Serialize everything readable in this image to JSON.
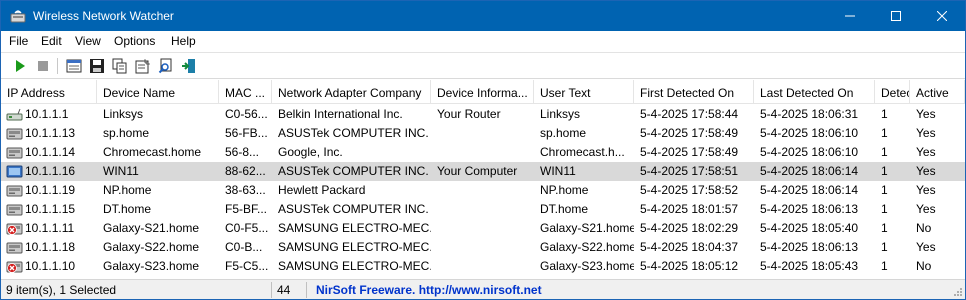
{
  "window": {
    "title": "Wireless Network Watcher"
  },
  "colors": {
    "titlebar": "#0063b1",
    "selected_row": "#d9d9d9",
    "link": "#0033cc",
    "error_red": "#d42020"
  },
  "menu": [
    "File",
    "Edit",
    "View",
    "Options",
    "Help"
  ],
  "toolbar_icons": [
    "play-icon",
    "stop-icon",
    "html-report-icon",
    "save-icon",
    "copy-icon",
    "properties-icon",
    "find-icon",
    "exit-icon"
  ],
  "columns": [
    "IP Address",
    "Device Name",
    "MAC ...",
    "Network Adapter Company",
    "Device Informa...",
    "User Text",
    "First Detected On",
    "Last Detected On",
    "Detec",
    "Active"
  ],
  "rows": [
    {
      "icon": "router-icon",
      "ip": "10.1.1.1",
      "name": "Linksys",
      "mac": "C0-56...",
      "company": "Belkin International Inc.",
      "info": "Your Router",
      "user_text": "Linksys",
      "first": "5-4-2025  17:58:44",
      "last": "5-4-2025  18:06:31",
      "count": "1",
      "active": "Yes",
      "selected": false
    },
    {
      "icon": "device-icon",
      "ip": "10.1.1.13",
      "name": "sp.home",
      "mac": "56-FB...",
      "company": "ASUSTek COMPUTER INC.",
      "info": "",
      "user_text": "sp.home",
      "first": "5-4-2025  17:58:49",
      "last": "5-4-2025  18:06:10",
      "count": "1",
      "active": "Yes",
      "selected": false
    },
    {
      "icon": "device-icon",
      "ip": "10.1.1.14",
      "name": "Chromecast.home",
      "mac": "56-8...",
      "company": "Google, Inc.",
      "info": "",
      "user_text": "Chromecast.h...",
      "first": "5-4-2025  17:58:49",
      "last": "5-4-2025  18:06:10",
      "count": "1",
      "active": "Yes",
      "selected": false
    },
    {
      "icon": "computer-icon",
      "ip": "10.1.1.16",
      "name": "WIN11",
      "mac": "88-62...",
      "company": "ASUSTek COMPUTER INC.",
      "info": "Your Computer",
      "user_text": "WIN11",
      "first": "5-4-2025  17:58:51",
      "last": "5-4-2025  18:06:14",
      "count": "1",
      "active": "Yes",
      "selected": true
    },
    {
      "icon": "device-icon",
      "ip": "10.1.1.19",
      "name": "NP.home",
      "mac": "38-63...",
      "company": "Hewlett Packard",
      "info": "",
      "user_text": "NP.home",
      "first": "5-4-2025  17:58:52",
      "last": "5-4-2025  18:06:14",
      "count": "1",
      "active": "Yes",
      "selected": false
    },
    {
      "icon": "device-icon",
      "ip": "10.1.1.15",
      "name": "DT.home",
      "mac": "F5-BF...",
      "company": "ASUSTek COMPUTER INC.",
      "info": "",
      "user_text": "DT.home",
      "first": "5-4-2025  18:01:57",
      "last": "5-4-2025  18:06:13",
      "count": "1",
      "active": "Yes",
      "selected": false
    },
    {
      "icon": "device-inactive-icon",
      "ip": "10.1.1.11",
      "name": "Galaxy-S21.home",
      "mac": "C0-F5...",
      "company": "SAMSUNG ELECTRO-MEC...",
      "info": "",
      "user_text": "Galaxy-S21.home",
      "first": "5-4-2025  18:02:29",
      "last": "5-4-2025  18:05:40",
      "count": "1",
      "active": "No",
      "selected": false
    },
    {
      "icon": "device-icon",
      "ip": "10.1.1.18",
      "name": "Galaxy-S22.home",
      "mac": "C0-B...",
      "company": "SAMSUNG ELECTRO-MEC...",
      "info": "",
      "user_text": "Galaxy-S22.home",
      "first": "5-4-2025  18:04:37",
      "last": "5-4-2025  18:06:13",
      "count": "1",
      "active": "Yes",
      "selected": false
    },
    {
      "icon": "device-inactive-icon",
      "ip": "10.1.1.10",
      "name": "Galaxy-S23.home",
      "mac": "F5-C5...",
      "company": "SAMSUNG ELECTRO-MEC...",
      "info": "",
      "user_text": "Galaxy-S23.home",
      "first": "5-4-2025  18:05:12",
      "last": "5-4-2025  18:05:43",
      "count": "1",
      "active": "No",
      "selected": false
    }
  ],
  "status": {
    "items": "9 item(s), 1 Selected",
    "count": "44",
    "freeware": "NirSoft Freeware.  http://www.nirsoft.net"
  }
}
